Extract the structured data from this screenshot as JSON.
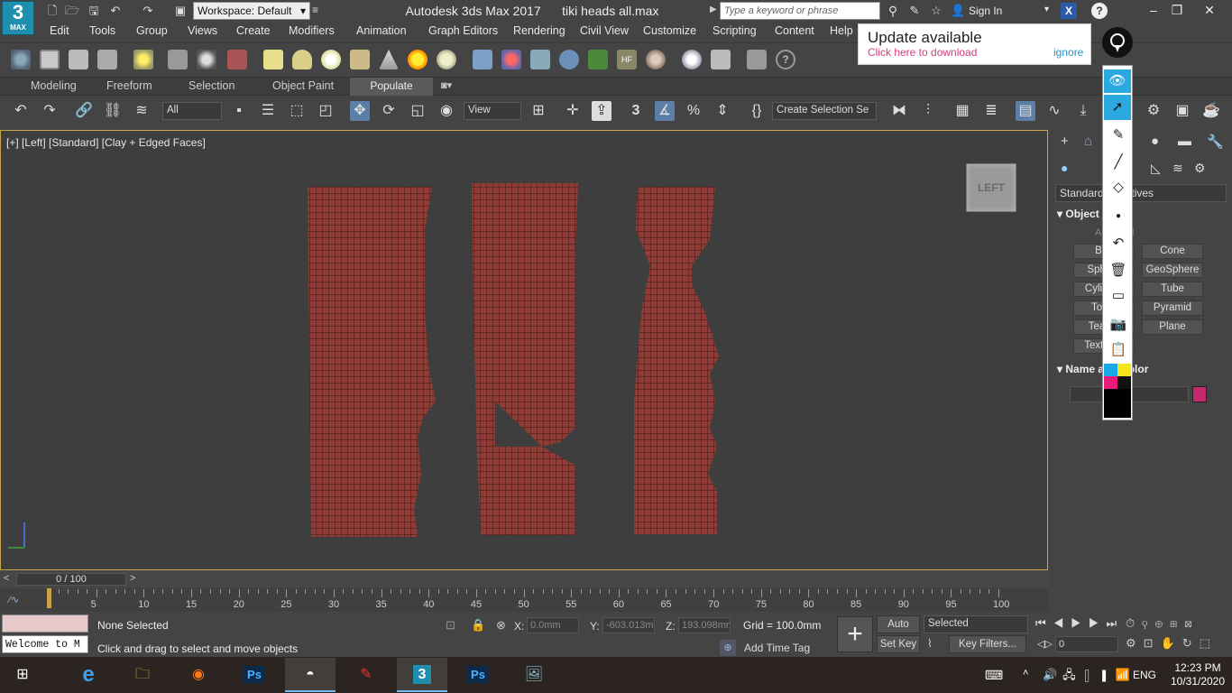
{
  "app": {
    "logo_big": "3",
    "logo_small": "MAX",
    "workspace": "Workspace: Default",
    "title": "Autodesk 3ds Max 2017",
    "file": "tiki heads all.max",
    "search_placeholder": "Type a keyword or phrase",
    "sign_in": "Sign In"
  },
  "menus": [
    "Edit",
    "Tools",
    "Group",
    "Views",
    "Create",
    "Modifiers",
    "Animation",
    "Graph Editors",
    "Rendering",
    "Civil View",
    "Customize",
    "Scripting",
    "Content",
    "Help"
  ],
  "ribbon_tabs": [
    "Modeling",
    "Freeform",
    "Selection",
    "Object Paint",
    "Populate"
  ],
  "toolbar2": {
    "filter": "All",
    "refcoord": "View",
    "selection_set": "Create Selection Se"
  },
  "viewport": {
    "label": "[+] [Left] [Standard] [Clay + Edged Faces]",
    "viewcube": "LEFT",
    "mesh_color": "#8f3b36"
  },
  "command_panel": {
    "category": "Standard Primitives",
    "object_type": "Object Type",
    "autogrid": "AutoGrid",
    "buttons_left": [
      "Box",
      "Sphere",
      "Cylinder",
      "Torus",
      "Teapot",
      "TextPlus"
    ],
    "buttons_right": [
      "Cone",
      "GeoSphere",
      "Tube",
      "Pyramid",
      "Plane"
    ],
    "name_color": "Name and Color",
    "swatch_color": "#c42b6e"
  },
  "update": {
    "title": "Update available",
    "link": "Click here to download",
    "ignore": "ignore"
  },
  "timeline": {
    "frame": "0 / 100",
    "ticks": [
      "0",
      "5",
      "10",
      "15",
      "20",
      "25",
      "30",
      "35",
      "40",
      "45",
      "50",
      "55",
      "60",
      "65",
      "70",
      "75",
      "80",
      "85",
      "90",
      "95",
      "100"
    ]
  },
  "status": {
    "maxscript": "Welcome to M",
    "selection": "None Selected",
    "prompt": "Click and drag to select and move objects",
    "x_label": "X:",
    "x": "0.0mm",
    "y_label": "Y:",
    "y": "-603.013mm",
    "z_label": "Z:",
    "z": "193.098mm",
    "grid": "Grid = 100.0mm",
    "add_time_tag": "Add Time Tag",
    "auto_key": "Auto Key",
    "set_key": "Set Key",
    "key_mode": "Selected",
    "key_filters": "Key Filters...",
    "frame_field": "0"
  },
  "taskbar": {
    "lang": "ENG",
    "time": "12:23 PM",
    "date": "10/31/2020"
  }
}
